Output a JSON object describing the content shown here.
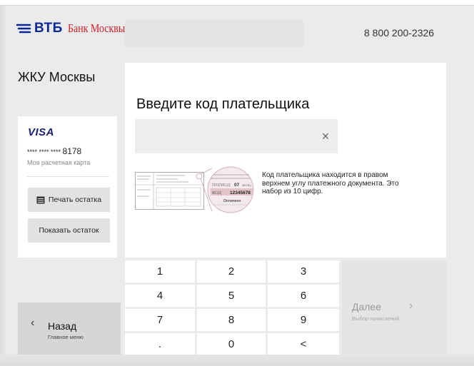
{
  "brand": {
    "vtb": "ВТБ",
    "bank_name": "Банк Москвы"
  },
  "header": {
    "phone": "8 800 200-2326"
  },
  "service": {
    "title": "ЖКУ Москвы"
  },
  "card": {
    "brand": "VISA",
    "masked_prefix": "**** **** **** ",
    "last4": "8178",
    "name": "Моя расчетная карта",
    "print_balance_label": "Печать остатка",
    "show_balance_label": "Показать остаток"
  },
  "form": {
    "prompt": "Введите код плательщика",
    "input_value": "",
    "clear_symbol": "×",
    "hint": "Код плательщика находится в правом верхнем углу платежного документа. Это набор из 10 цифр.",
    "doc_period_label": "ПЕРИОД",
    "doc_period_value": "07",
    "doc_period_unit": "месяц",
    "doc_code_label": "КОД",
    "doc_code_value": "12345678",
    "doc_paid_label": "Оплачено"
  },
  "keypad": {
    "keys": [
      "1",
      "2",
      "3",
      "4",
      "5",
      "6",
      "7",
      "8",
      "9",
      ".",
      "0",
      "<"
    ]
  },
  "next": {
    "label": "Далее",
    "arrow": "›",
    "sub": "Выбор начислений"
  },
  "back": {
    "arrow": "‹",
    "label": "Назад",
    "sub": "Главное меню"
  },
  "colors": {
    "vtb_blue": "#0a2896",
    "bank_red": "#d41f26",
    "visa_blue": "#1a1f71",
    "background": "#ebebeb"
  }
}
